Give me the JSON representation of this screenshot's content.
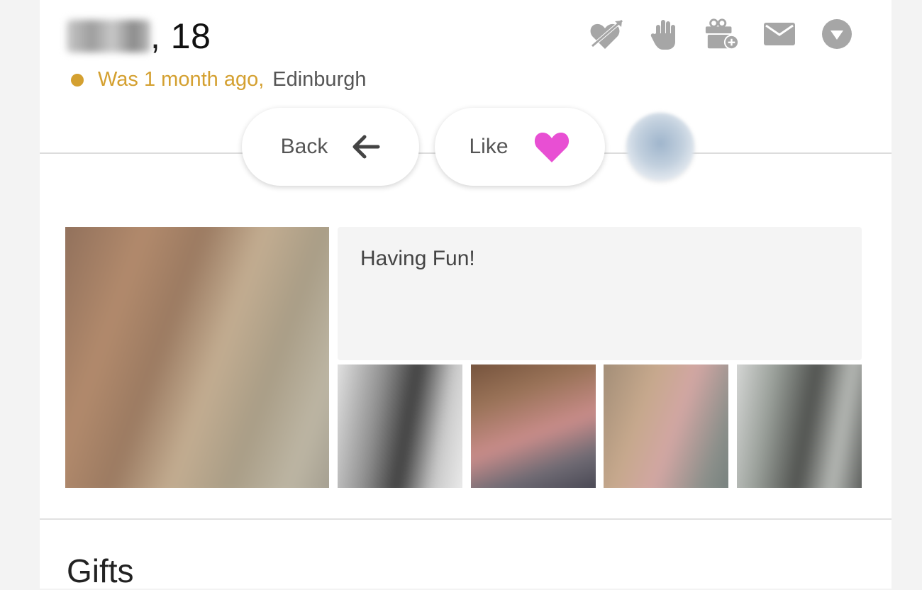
{
  "profile": {
    "name_suffix": ", 18",
    "status_text": "Was 1 month ago,",
    "location": "Edinburgh",
    "status_color": "#d4a030",
    "about": "Having Fun!"
  },
  "icons": [
    {
      "name": "heart-arrow-icon"
    },
    {
      "name": "wave-hand-icon"
    },
    {
      "name": "gift-add-icon"
    },
    {
      "name": "mail-icon"
    },
    {
      "name": "dropdown-icon"
    }
  ],
  "actions": {
    "back_label": "Back",
    "like_label": "Like",
    "like_heart_color": "#e84fd3"
  },
  "colors": {
    "icon_gray": "#a6a6a6"
  },
  "sections": {
    "gifts_title": "Gifts"
  }
}
